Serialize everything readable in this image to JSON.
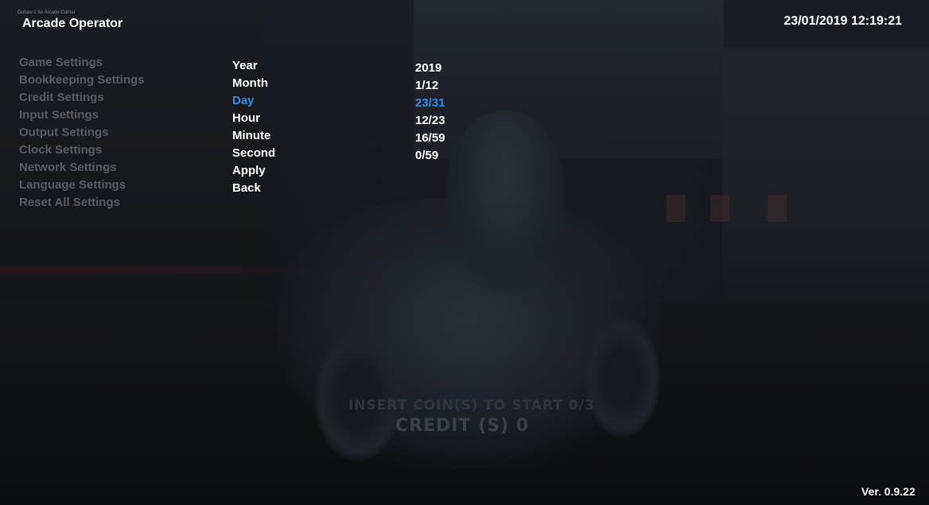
{
  "header": {
    "small_tag": "Outlaw 1 for Arcade Corner",
    "title": "Arcade Operator",
    "datetime": "23/01/2019  12:19:21"
  },
  "menu": {
    "items": [
      {
        "label": "Game Settings"
      },
      {
        "label": "Bookkeeping Settings"
      },
      {
        "label": "Credit Settings"
      },
      {
        "label": "Input Settings"
      },
      {
        "label": "Output Settings"
      },
      {
        "label": "Clock Settings"
      },
      {
        "label": "Network Settings"
      },
      {
        "label": "Language Settings"
      },
      {
        "label": "Reset All Settings"
      }
    ]
  },
  "clock_settings": {
    "options": [
      {
        "label": "Year",
        "value": "2019"
      },
      {
        "label": "Month",
        "value": "1/12"
      },
      {
        "label": "Day",
        "value": "23/31"
      },
      {
        "label": "Hour",
        "value": "12/23"
      },
      {
        "label": "Minute",
        "value": "16/59"
      },
      {
        "label": "Second",
        "value": "0/59"
      },
      {
        "label": "Apply"
      },
      {
        "label": "Back"
      }
    ],
    "selected_label": "Day"
  },
  "game_background": {
    "insert_coin": "INSERT COIN(S) TO START 0/3",
    "credit": "CREDIT (S)  0"
  },
  "footer": {
    "version": "Ver. 0.9.22"
  },
  "colors": {
    "selected": "#2f8ee8",
    "text": "#ffffff",
    "inactive_menu": "#5a5c62"
  }
}
